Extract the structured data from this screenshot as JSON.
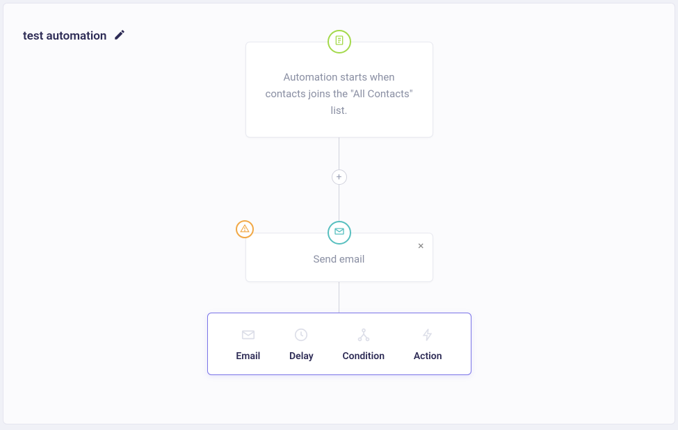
{
  "automation": {
    "title": "test automation"
  },
  "trigger": {
    "description": "Automation starts when contacts joins the \"All Contacts\" list."
  },
  "step_email": {
    "label": "Send email"
  },
  "toolbox": {
    "email": "Email",
    "delay": "Delay",
    "condition": "Condition",
    "action": "Action"
  },
  "add_button": "+",
  "close_button": "×"
}
